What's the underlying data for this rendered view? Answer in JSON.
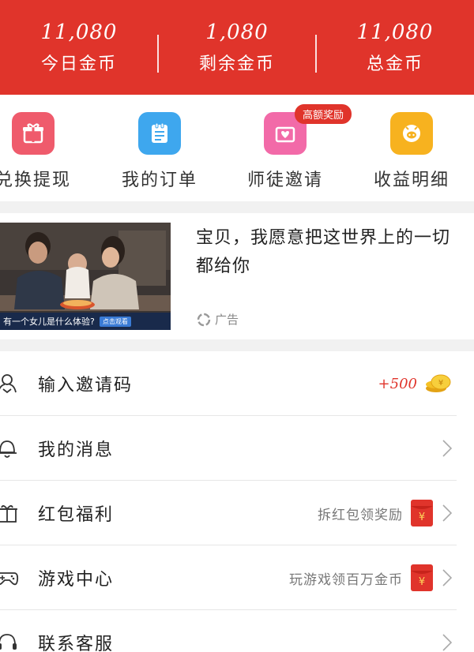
{
  "stats": [
    {
      "value": "11,080",
      "label": "今日金币"
    },
    {
      "value": "1,080",
      "label": "剩余金币"
    },
    {
      "value": "11,080",
      "label": "总金币"
    }
  ],
  "actions": [
    {
      "label": "兑换提现",
      "icon": "gift-icon",
      "color": "#ef5b6c"
    },
    {
      "label": "我的订单",
      "icon": "order-list-icon",
      "color": "#3ea7ee"
    },
    {
      "label": "师徒邀请",
      "icon": "invite-heart-icon",
      "color": "#f26aa8",
      "badge": "高额奖励"
    },
    {
      "label": "收益明细",
      "icon": "piggy-bank-icon",
      "color": "#f7b21f"
    }
  ],
  "ad": {
    "title": "宝贝，我愿意把这世界上的一切都给你",
    "image_caption": "有一个女儿是什么体验?",
    "image_tag": "点击观看",
    "mark": "广告"
  },
  "menu": [
    {
      "label": "输入邀请码",
      "icon": "invite-code-icon",
      "reward": "+500",
      "coin": true
    },
    {
      "label": "我的消息",
      "icon": "message-bell-icon"
    },
    {
      "label": "红包福利",
      "icon": "red-packet-gift-icon",
      "hint": "拆红包领奖励",
      "envelope": true
    },
    {
      "label": "游戏中心",
      "icon": "gamepad-icon",
      "hint": "玩游戏领百万金币",
      "envelope": true
    },
    {
      "label": "联系客服",
      "icon": "customer-service-icon"
    }
  ],
  "colors": {
    "primary": "#e0342b",
    "divider": "#f1f1f1"
  }
}
